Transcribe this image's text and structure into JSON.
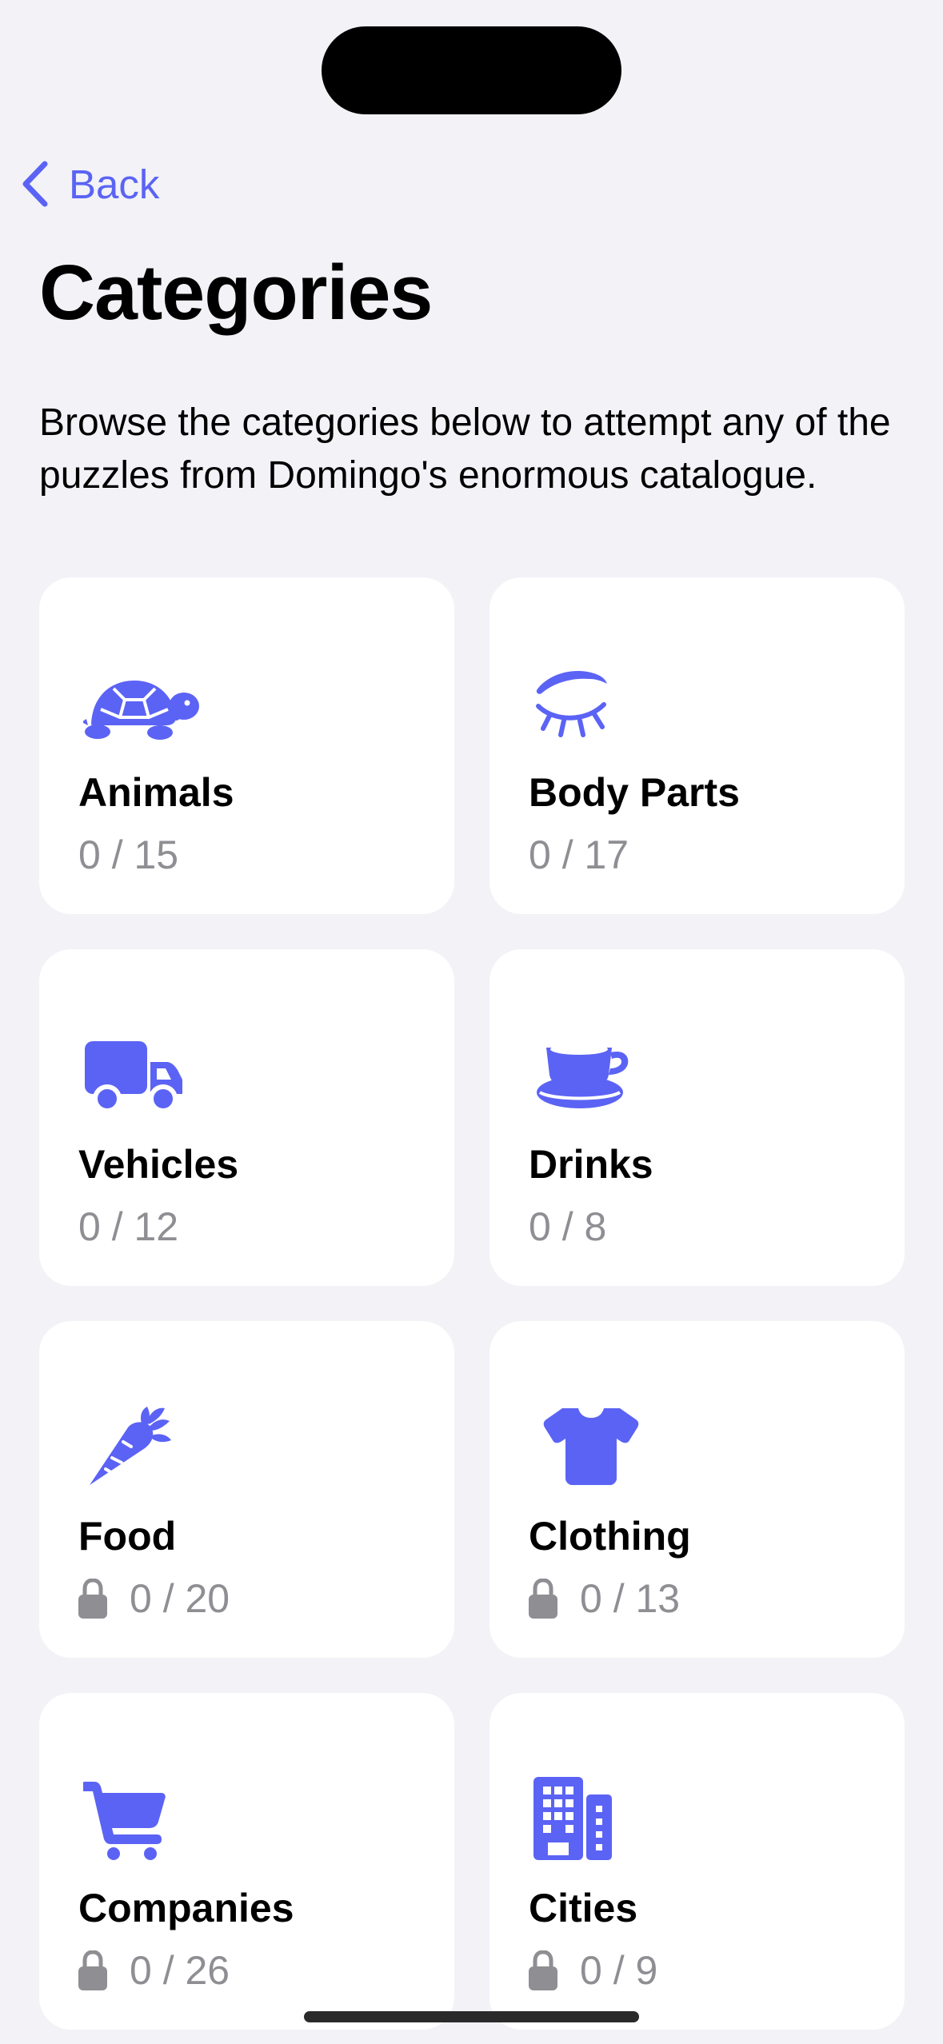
{
  "nav": {
    "back_label": "Back"
  },
  "header": {
    "title": "Categories",
    "description": "Browse the categories below to attempt any of the puzzles from Domingo's enormous catalogue."
  },
  "theme": {
    "accent": "#5b63f5",
    "background": "#f2f2f7",
    "card": "#ffffff",
    "secondary_text": "#8e8e93"
  },
  "categories": [
    {
      "name": "Animals",
      "progress": "0 / 15",
      "icon": "tortoise-icon",
      "locked": false
    },
    {
      "name": "Body Parts",
      "progress": "0 / 17",
      "icon": "eye-icon",
      "locked": false
    },
    {
      "name": "Vehicles",
      "progress": "0 / 12",
      "icon": "truck-icon",
      "locked": false
    },
    {
      "name": "Drinks",
      "progress": "0 / 8",
      "icon": "cup-and-saucer-icon",
      "locked": false
    },
    {
      "name": "Food",
      "progress": "0 / 20",
      "icon": "carrot-icon",
      "locked": true
    },
    {
      "name": "Clothing",
      "progress": "0 / 13",
      "icon": "tshirt-icon",
      "locked": true
    },
    {
      "name": "Companies",
      "progress": "0 / 26",
      "icon": "cart-icon",
      "locked": true
    },
    {
      "name": "Cities",
      "progress": "0 / 9",
      "icon": "building-icon",
      "locked": true
    }
  ]
}
